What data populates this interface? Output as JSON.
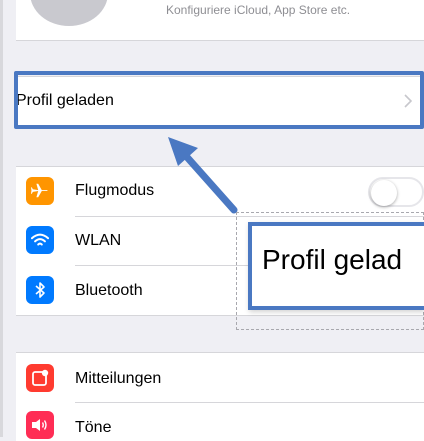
{
  "header": {
    "subtitle": "Konfiguriere iCloud, App Store etc."
  },
  "profile_row": {
    "label": "Profil geladen"
  },
  "settings": {
    "airplane": {
      "label": "Flugmodus",
      "icon": "airplane-icon",
      "color": "#ff9500",
      "toggle_on": false
    },
    "wlan": {
      "label": "WLAN",
      "icon": "wifi-icon",
      "color": "#007aff"
    },
    "bluetooth": {
      "label": "Bluetooth",
      "icon": "bluetooth-icon",
      "color": "#007aff"
    },
    "notifications": {
      "label": "Mitteilungen",
      "icon": "notifications-icon",
      "color": "#ff3b30"
    },
    "sounds": {
      "label": "Töne",
      "icon": "speaker-icon",
      "color": "#ff2d55"
    }
  },
  "annotation": {
    "callout_text": "Profil gelad",
    "accent": "#4a78c2"
  }
}
